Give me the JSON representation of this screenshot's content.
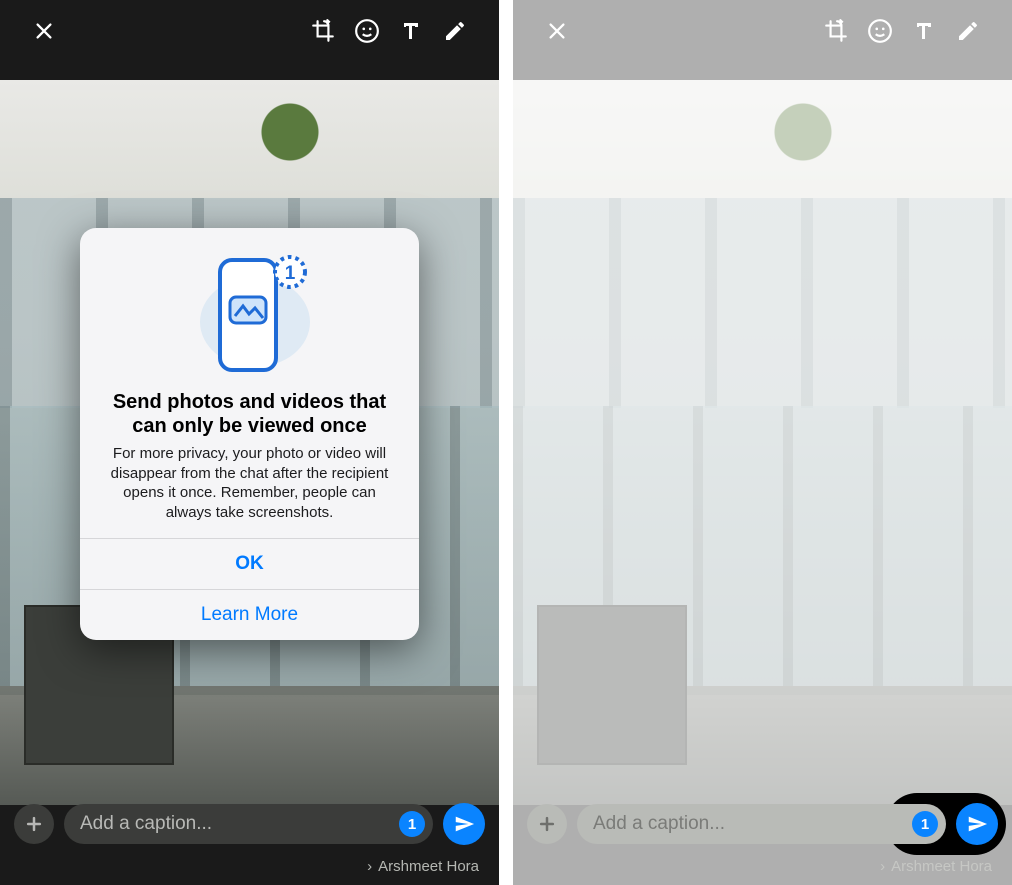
{
  "dialog": {
    "title": "Send photos and videos that can only be viewed once",
    "body": "For more privacy, your photo or video will disappear from the chat after the recipient opens it once. Remember, people can always take screenshots.",
    "ok": "OK",
    "learn": "Learn More",
    "badge_number": "1"
  },
  "caption_placeholder": "Add a caption...",
  "view_once_label": "1",
  "recipient_name": "Arshmeet Hora"
}
